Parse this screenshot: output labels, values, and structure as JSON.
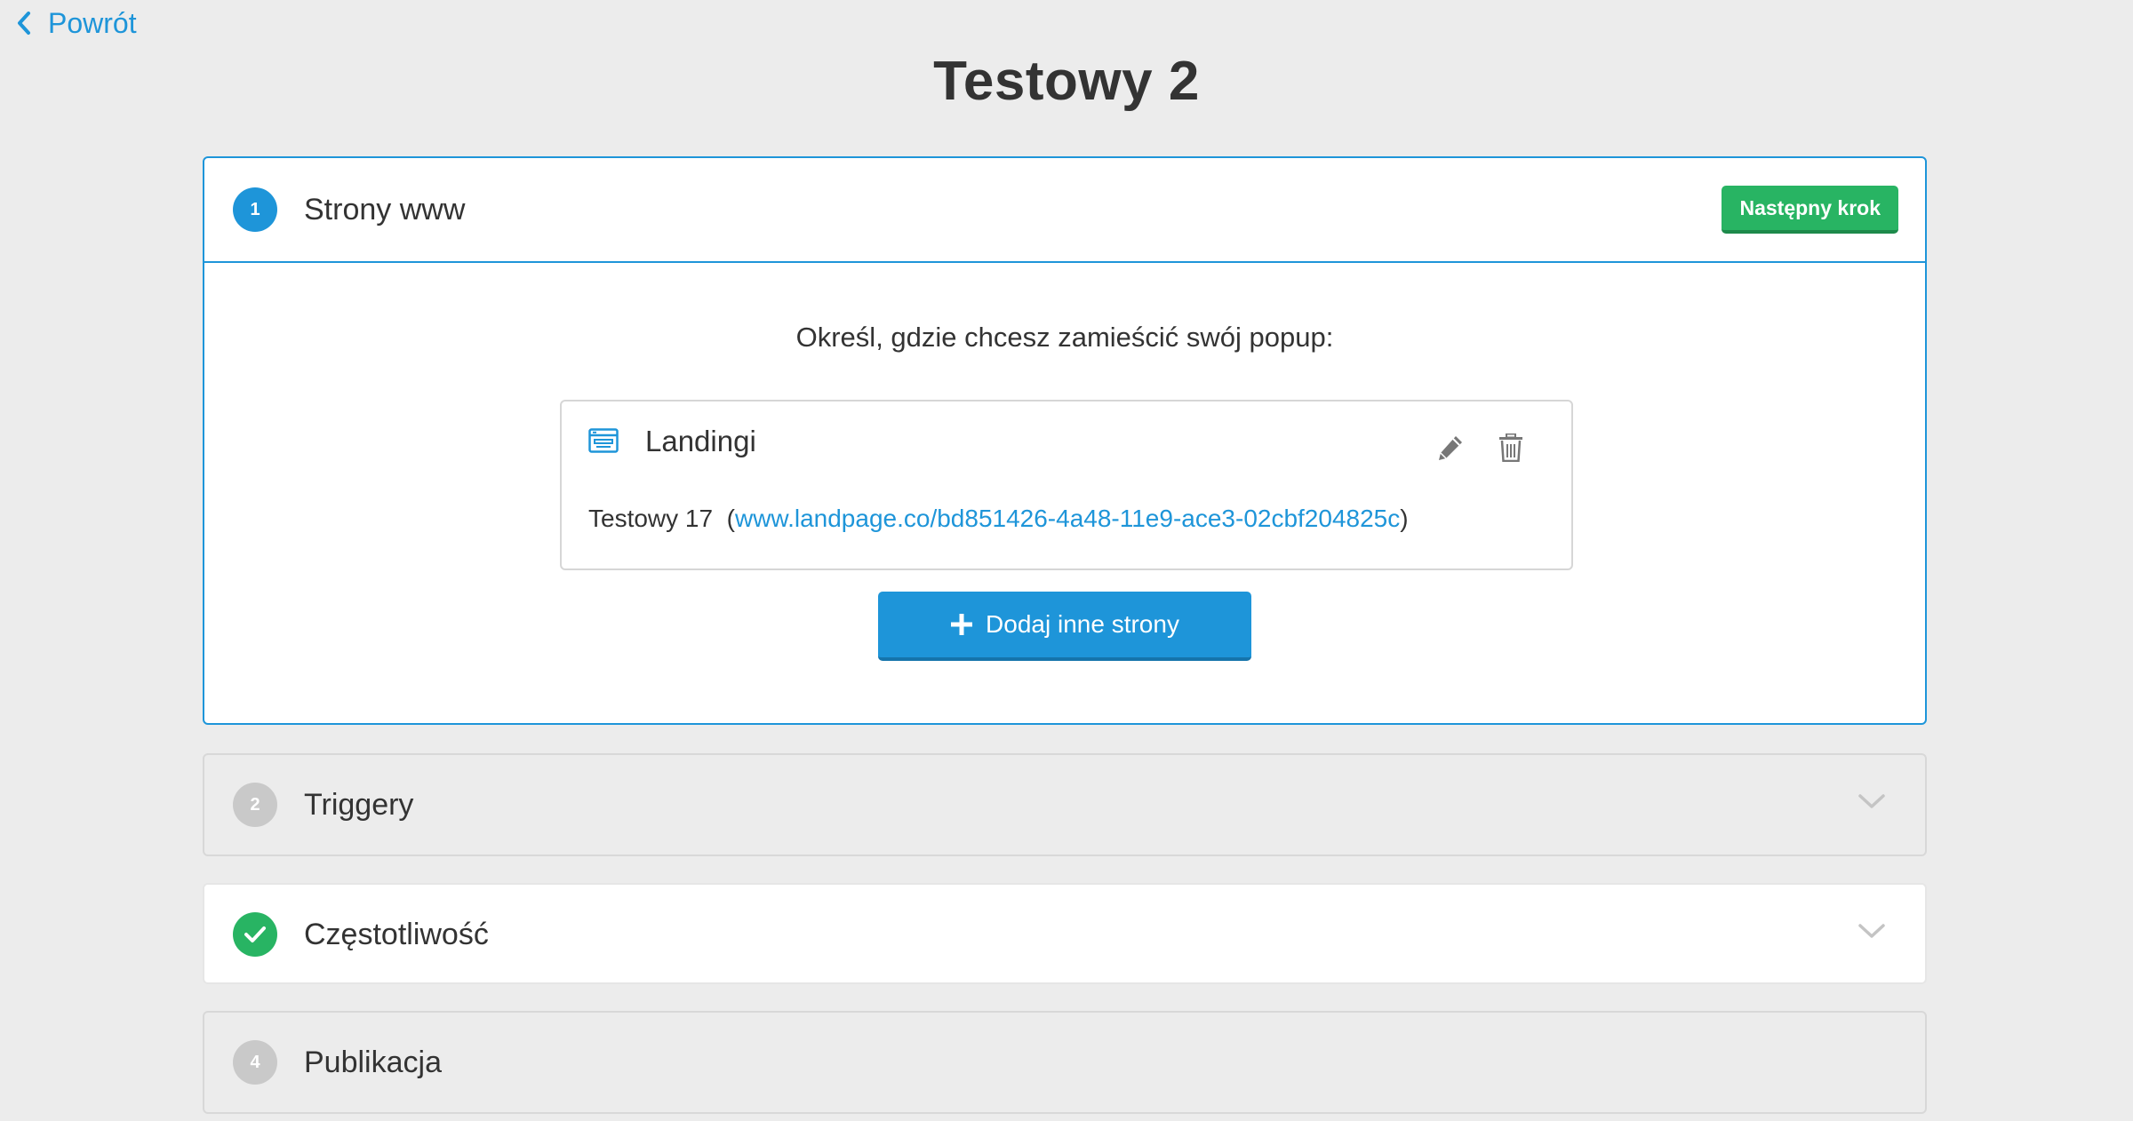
{
  "nav": {
    "back_label": "Powrót"
  },
  "page": {
    "title": "Testowy 2"
  },
  "steps": [
    {
      "number": "1",
      "title": "Strony www",
      "state": "active",
      "action_label": "Następny krok"
    },
    {
      "number": "2",
      "title": "Triggery",
      "state": "disabled"
    },
    {
      "number": "3",
      "title": "Częstotliwość",
      "state": "completed"
    },
    {
      "number": "4",
      "title": "Publikacja",
      "state": "disabled"
    }
  ],
  "websites": {
    "instruction": "Określ, gdzie chcesz zamieścić swój popup:",
    "card": {
      "icon": "browser-window-icon",
      "name": "Landingi",
      "page_name": "Testowy 17",
      "open_paren": "(",
      "url": "www.landpage.co/bd851426-4a48-11e9-ace3-02cbf204825c",
      "close_paren": ")"
    },
    "add_label": "Dodaj inne strony"
  },
  "colors": {
    "accent": "#1e95d9",
    "success": "#28b463",
    "disabled": "#c9c9c9",
    "background": "#ececec"
  }
}
